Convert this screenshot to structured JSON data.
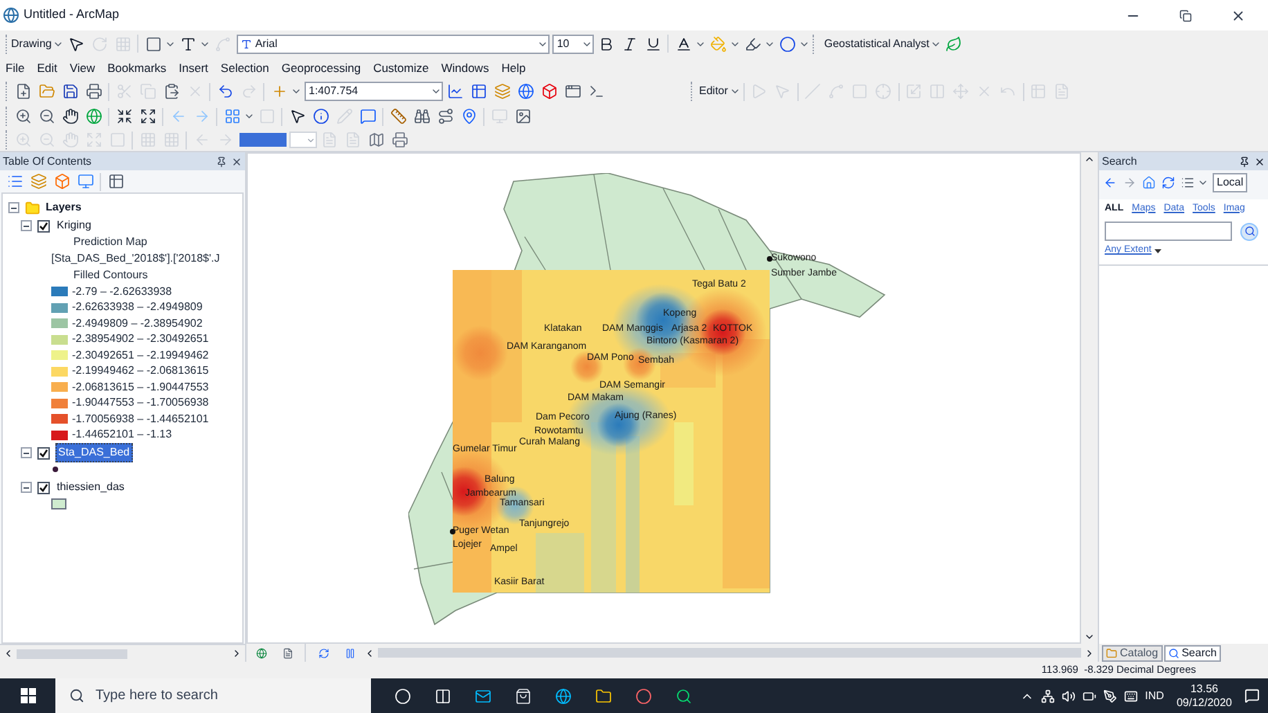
{
  "window": {
    "title": "Untitled - ArcMap"
  },
  "drawing_toolbar": {
    "label": "Drawing",
    "font": "Arial",
    "font_size": "10",
    "analyst_label": "Geostatistical Analyst"
  },
  "menu": [
    "File",
    "Edit",
    "View",
    "Bookmarks",
    "Insert",
    "Selection",
    "Geoprocessing",
    "Customize",
    "Windows",
    "Help"
  ],
  "standard_toolbar": {
    "scale": "1:407.754"
  },
  "editor_toolbar": {
    "label": "Editor"
  },
  "toc": {
    "title": "Table Of Contents",
    "root": {
      "label": "Layers",
      "expanded": true
    },
    "layers": [
      {
        "name": "Kriging",
        "kind": "raster",
        "checked": true,
        "selected": false,
        "expanded": true,
        "details": [
          "Prediction Map",
          "[Sta_DAS_Bed_'2018$'].['2018$'.J",
          "Filled Contours"
        ],
        "classes": [
          {
            "label": "-2.79 – -2.62633938",
            "color": "#2b7bba"
          },
          {
            "label": "-2.62633938 – -2.4949809",
            "color": "#62a1b3"
          },
          {
            "label": "-2.4949809 – -2.38954902",
            "color": "#9cc5a3"
          },
          {
            "label": "-2.38954902 – -2.30492651",
            "color": "#c9de8f"
          },
          {
            "label": "-2.30492651 – -2.19949462",
            "color": "#eef28a"
          },
          {
            "label": "-2.19949462 – -2.06813615",
            "color": "#fcd863"
          },
          {
            "label": "-2.06813615 – -1.90447553",
            "color": "#f8ae4e"
          },
          {
            "label": "-1.90447553 – -1.70056938",
            "color": "#f0803a"
          },
          {
            "label": "-1.70056938 – -1.44652101",
            "color": "#e5512a"
          },
          {
            "label": "-1.44652101 – -1.13",
            "color": "#d7191c"
          }
        ]
      },
      {
        "name": "Sta_DAS_Bed",
        "kind": "points",
        "checked": true,
        "selected": true,
        "expanded": true
      },
      {
        "name": "thiessien_das",
        "kind": "polygons",
        "checked": true,
        "selected": false,
        "expanded": true
      }
    ]
  },
  "map_labels": [
    "Tegal Batu 2",
    "Sukowono",
    "Sumber Jambe",
    "Kopeng",
    "DAM Manggis",
    "Arjasa 2",
    "KOTTOK",
    "Bintoro (Kasmaran 2)",
    "Klatakan",
    "DAM Karanganom",
    "DAM Pono",
    "Sembah",
    "DAM Semangir",
    "DAM Makam",
    "Dam Pecoro",
    "Ajung (Ranes)",
    "Rowotamtu",
    "Curah Malang",
    "Gumelar Timur",
    "Balung",
    "Jambearum",
    "Tamansari",
    "Tanjungrejo",
    "Puger Wetan",
    "Lojejer",
    "Ampel",
    "Kasiir Barat"
  ],
  "search": {
    "title": "Search",
    "scope": "Local",
    "filters": [
      {
        "label": "ALL",
        "selected": true
      },
      {
        "label": "Maps",
        "selected": false
      },
      {
        "label": "Data",
        "selected": false
      },
      {
        "label": "Tools",
        "selected": false
      },
      {
        "label": "Imag",
        "selected": false
      }
    ],
    "extent": "Any Extent"
  },
  "dock_tabs": [
    {
      "label": "Catalog",
      "selected": false
    },
    {
      "label": "Search",
      "selected": true
    }
  ],
  "status_bar": "113.969  -8.329 Decimal Degrees",
  "taskbar": {
    "search_placeholder": "Type here to search",
    "language": "IND",
    "time": "13.56",
    "date": "09/12/2020"
  }
}
